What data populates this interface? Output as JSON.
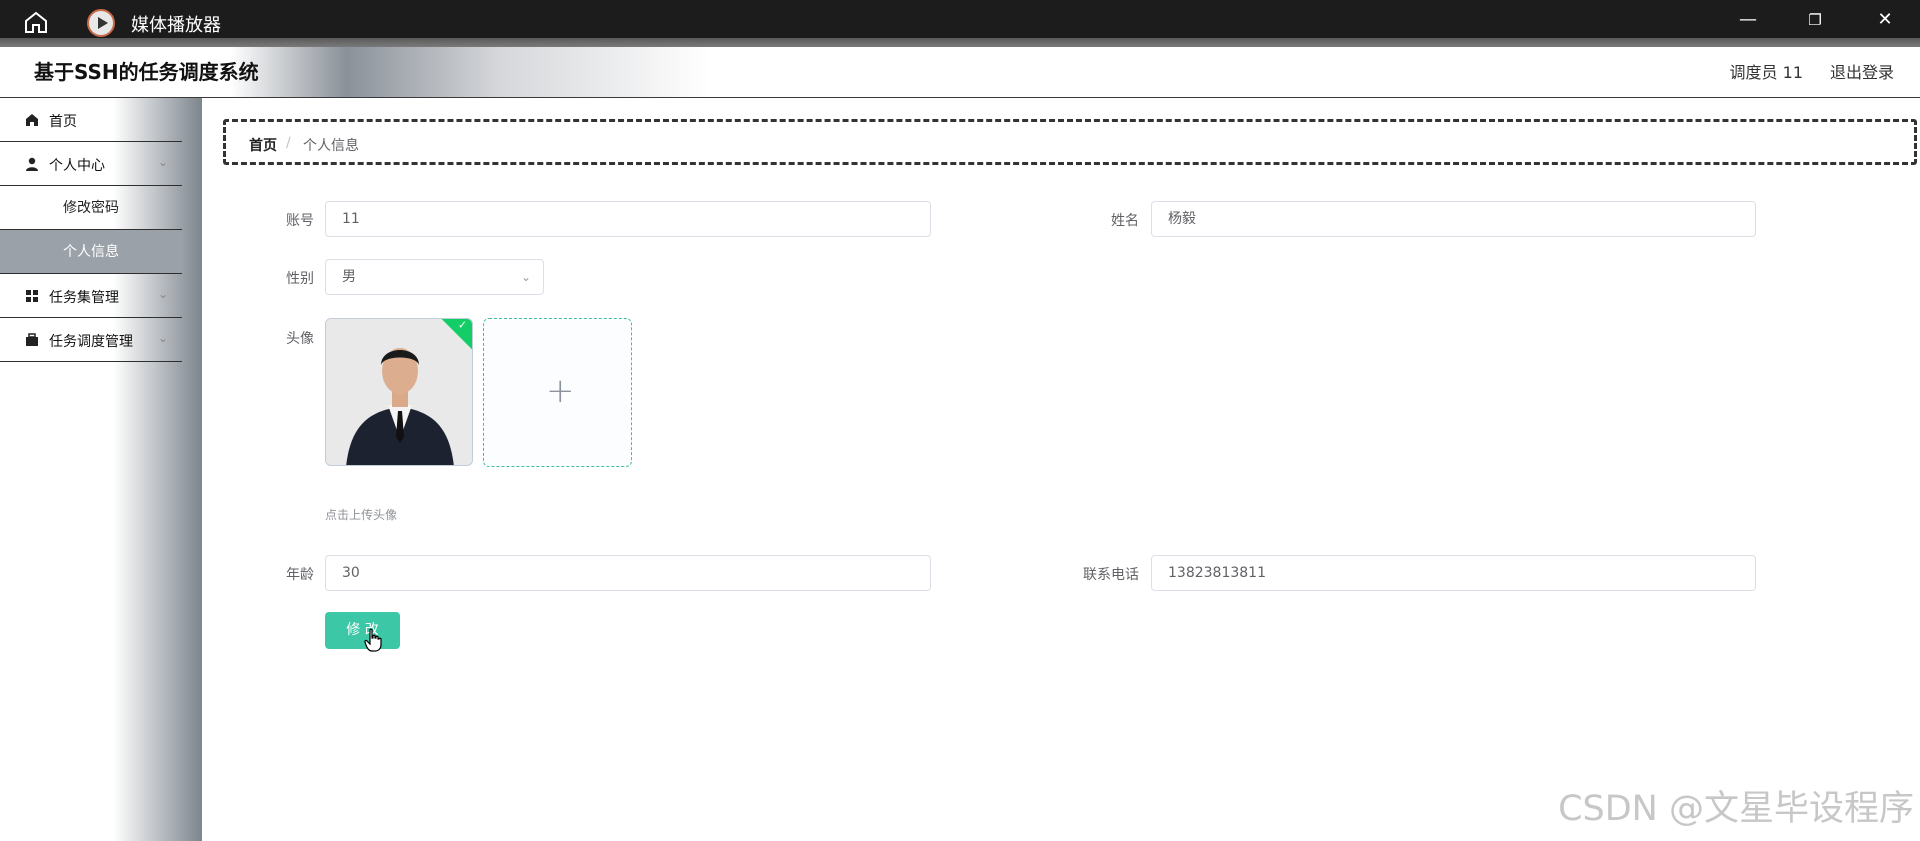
{
  "titlebar": {
    "title": "媒体播放器",
    "minimize_glyph": "—",
    "restore_glyph": "❐",
    "close_glyph": "✕"
  },
  "header": {
    "system_title": "基于SSH的任务调度系统",
    "user": "调度员 11",
    "logout": "退出登录"
  },
  "sidebar": {
    "items": [
      {
        "label": "首页",
        "icon": "home-icon"
      },
      {
        "label": "个人中心",
        "icon": "user-icon"
      },
      {
        "label": "修改密码"
      },
      {
        "label": "个人信息",
        "active": true
      },
      {
        "label": "任务集管理",
        "icon": "grid-icon"
      },
      {
        "label": "任务调度管理",
        "icon": "briefcase-icon"
      }
    ],
    "chevron_glyph": "⌄"
  },
  "breadcrumb": {
    "home": "首页",
    "separator": "/",
    "current": "个人信息"
  },
  "form": {
    "account_label": "账号",
    "account_value": "11",
    "name_label": "姓名",
    "name_value": "杨毅",
    "gender_label": "性别",
    "gender_value": "男",
    "avatar_label": "头像",
    "upload_tip": "点击上传头像",
    "age_label": "年龄",
    "age_value": "30",
    "phone_label": "联系电话",
    "phone_value": "13823813811",
    "submit_label": "修 改"
  },
  "watermark": "CSDN @文星毕设程序",
  "colors": {
    "accent": "#3cc7a6",
    "success": "#13ce66"
  }
}
